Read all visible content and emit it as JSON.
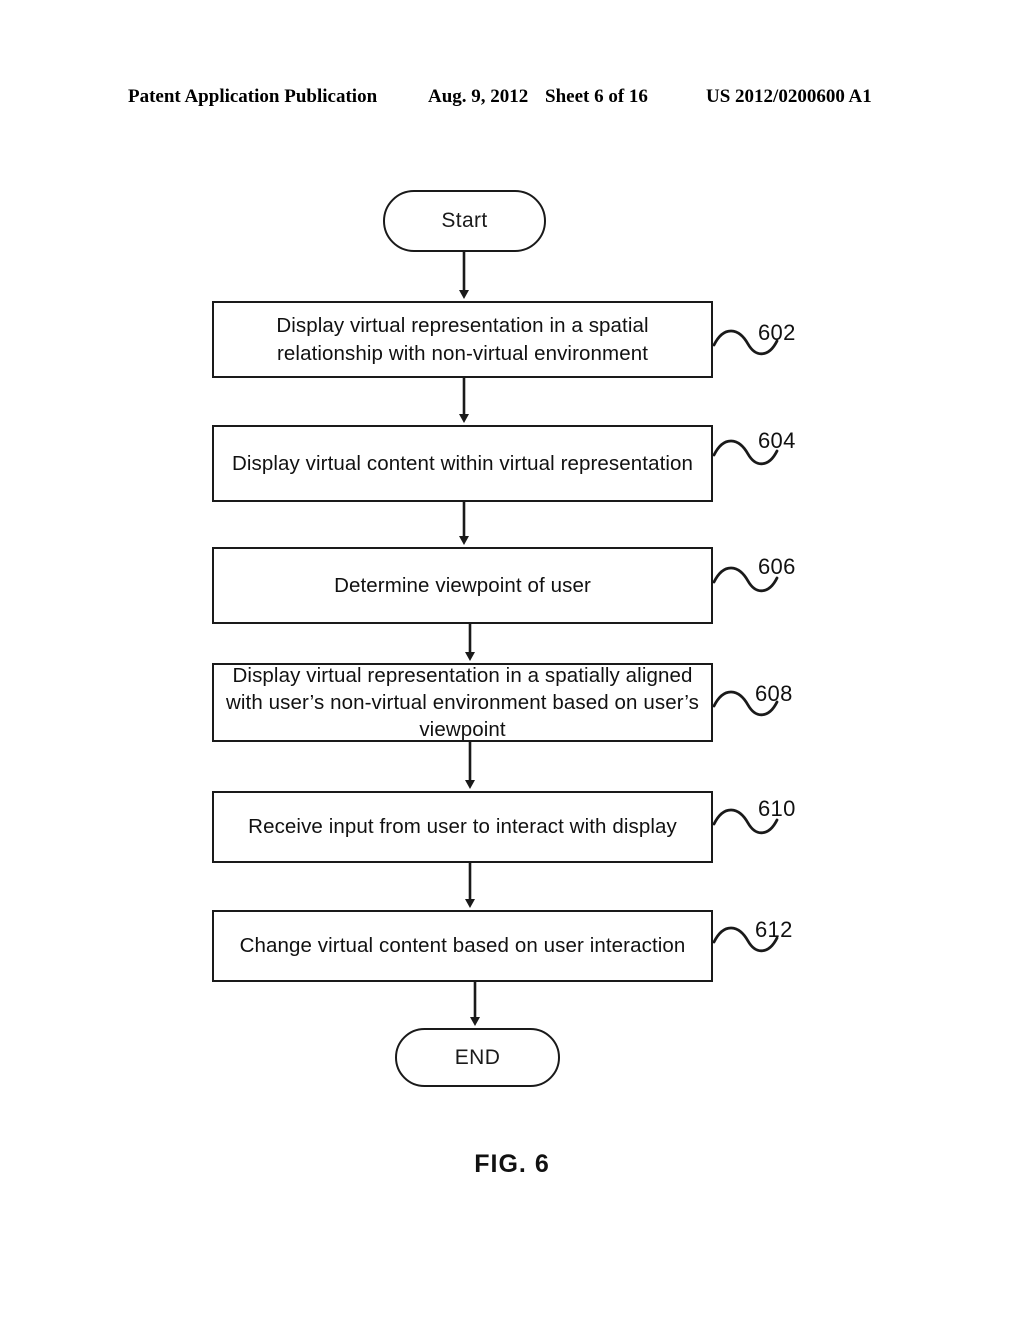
{
  "header": {
    "publication": "Patent Application Publication",
    "date": "Aug. 9, 2012",
    "sheet": "Sheet 6 of 16",
    "patent_number": "US 2012/0200600 A1"
  },
  "figure": {
    "caption": "FIG. 6",
    "type": "flowchart"
  },
  "flowchart": {
    "start_label": "Start",
    "end_label": "END",
    "steps": [
      {
        "ref": "602",
        "text": "Display virtual representation in a spatial\nrelationship with non-virtual environment"
      },
      {
        "ref": "604",
        "text": "Display virtual content within virtual representation"
      },
      {
        "ref": "606",
        "text": "Determine viewpoint of user"
      },
      {
        "ref": "608",
        "text": "Display virtual representation in a spatially aligned\nwith user’s non-virtual environment based on user’s\nviewpoint"
      },
      {
        "ref": "610",
        "text": "Receive input from user to interact with display"
      },
      {
        "ref": "612",
        "text": "Change virtual content based on user interaction"
      }
    ]
  },
  "colors": {
    "ink": "#1a1a1a",
    "page": "#ffffff"
  }
}
